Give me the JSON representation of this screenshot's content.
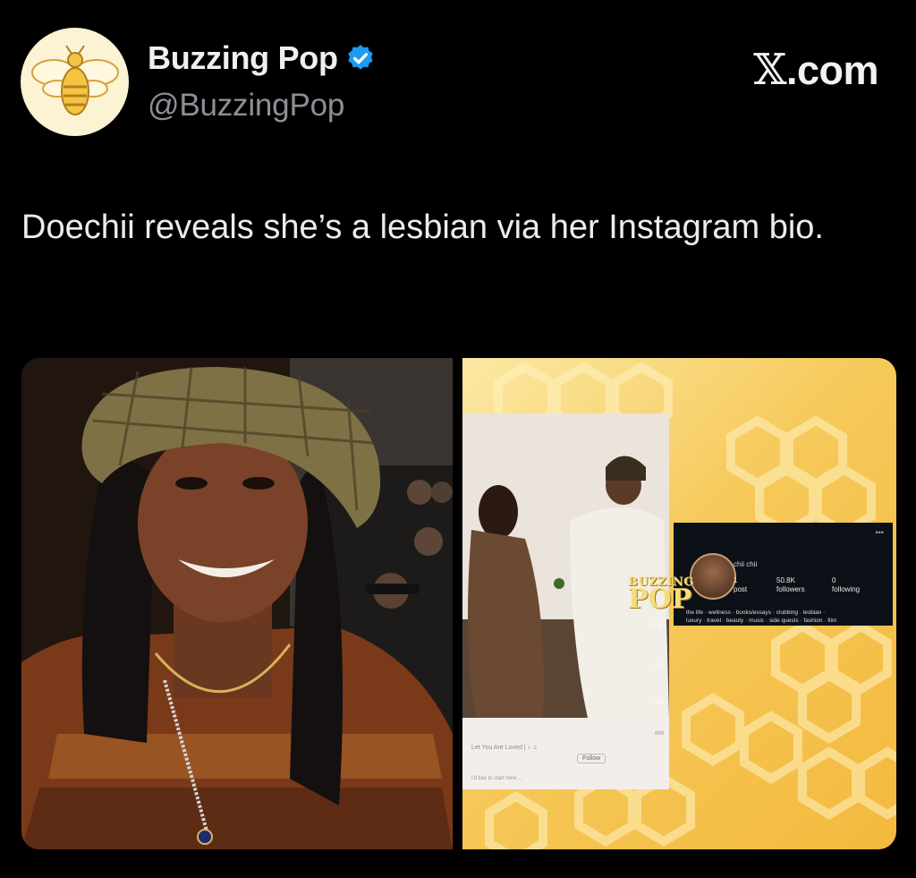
{
  "post": {
    "display_name": "Buzzing Pop",
    "handle": "@BuzzingPop",
    "brand_label": ".com",
    "brand_glyph": "𝕏",
    "text": "Doechii reveals she’s a lesbian via her Instagram bio.",
    "verified_icon": "verified-badge-icon",
    "avatar_icon": "bee-icon"
  },
  "instagram": {
    "profile_name": "chii chii",
    "posts_count": "1",
    "posts_label": "post",
    "followers_count": "50.8K",
    "followers_label": "followers",
    "following_count": "0",
    "following_label": "following",
    "bio_line1": "the life · wellness · books/essays · clubbing · lesbian ·",
    "bio_line2": "luxury · travel · beauty · music · side quests · fashion · film",
    "comment_text": "Let You Are Loved | ♪ ♫",
    "follow_label": "Follow",
    "caption_text": "I'd like to start here ...",
    "side_counts": [
      "52.1K",
      "327",
      "319",
      "869"
    ]
  },
  "watermark": {
    "line1": "BUZZING",
    "line2": "POP"
  },
  "colors": {
    "background": "#000000",
    "handle_gray": "#8b9096",
    "verified_blue": "#1d9bf0",
    "honey": "#f6c95a"
  }
}
